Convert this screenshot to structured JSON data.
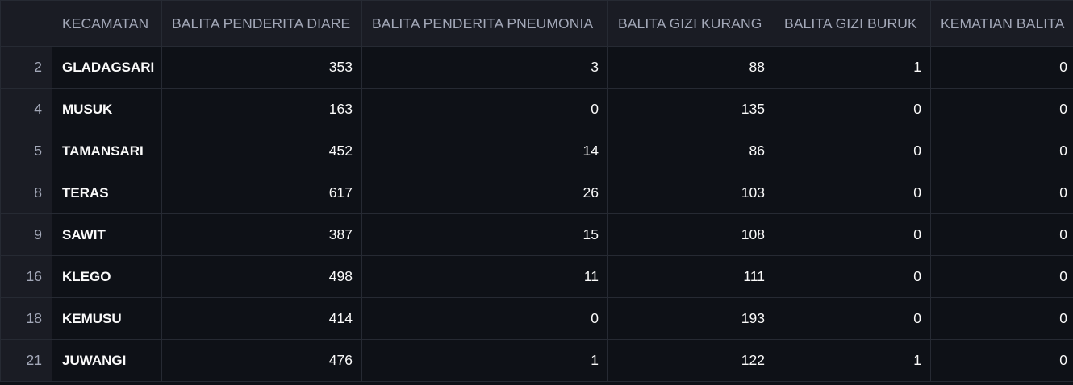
{
  "table": {
    "columns": [
      "",
      "KECAMATAN",
      "BALITA PENDERITA DIARE",
      "BALITA PENDERITA PNEUMONIA",
      "BALITA GIZI KURANG",
      "BALITA GIZI BURUK",
      "KEMATIAN BALITA"
    ],
    "rows": [
      {
        "index": "2",
        "kecamatan": "GLADAGSARI",
        "diare": "353",
        "pneumonia": "3",
        "gizi_kurang": "88",
        "gizi_buruk": "1",
        "kematian": "0"
      },
      {
        "index": "4",
        "kecamatan": "MUSUK",
        "diare": "163",
        "pneumonia": "0",
        "gizi_kurang": "135",
        "gizi_buruk": "0",
        "kematian": "0"
      },
      {
        "index": "5",
        "kecamatan": "TAMANSARI",
        "diare": "452",
        "pneumonia": "14",
        "gizi_kurang": "86",
        "gizi_buruk": "0",
        "kematian": "0"
      },
      {
        "index": "8",
        "kecamatan": "TERAS",
        "diare": "617",
        "pneumonia": "26",
        "gizi_kurang": "103",
        "gizi_buruk": "0",
        "kematian": "0"
      },
      {
        "index": "9",
        "kecamatan": "SAWIT",
        "diare": "387",
        "pneumonia": "15",
        "gizi_kurang": "108",
        "gizi_buruk": "0",
        "kematian": "0"
      },
      {
        "index": "16",
        "kecamatan": "KLEGO",
        "diare": "498",
        "pneumonia": "11",
        "gizi_kurang": "111",
        "gizi_buruk": "0",
        "kematian": "0"
      },
      {
        "index": "18",
        "kecamatan": "KEMUSU",
        "diare": "414",
        "pneumonia": "0",
        "gizi_kurang": "193",
        "gizi_buruk": "0",
        "kematian": "0"
      },
      {
        "index": "21",
        "kecamatan": "JUWANGI",
        "diare": "476",
        "pneumonia": "1",
        "gizi_kurang": "122",
        "gizi_buruk": "1",
        "kematian": "0"
      }
    ]
  },
  "colors": {
    "background": "#0e1117",
    "header_background": "#1a1c24",
    "header_text": "#a3a8b8",
    "cell_text": "#fafafa",
    "grid_line": "#262a33"
  }
}
